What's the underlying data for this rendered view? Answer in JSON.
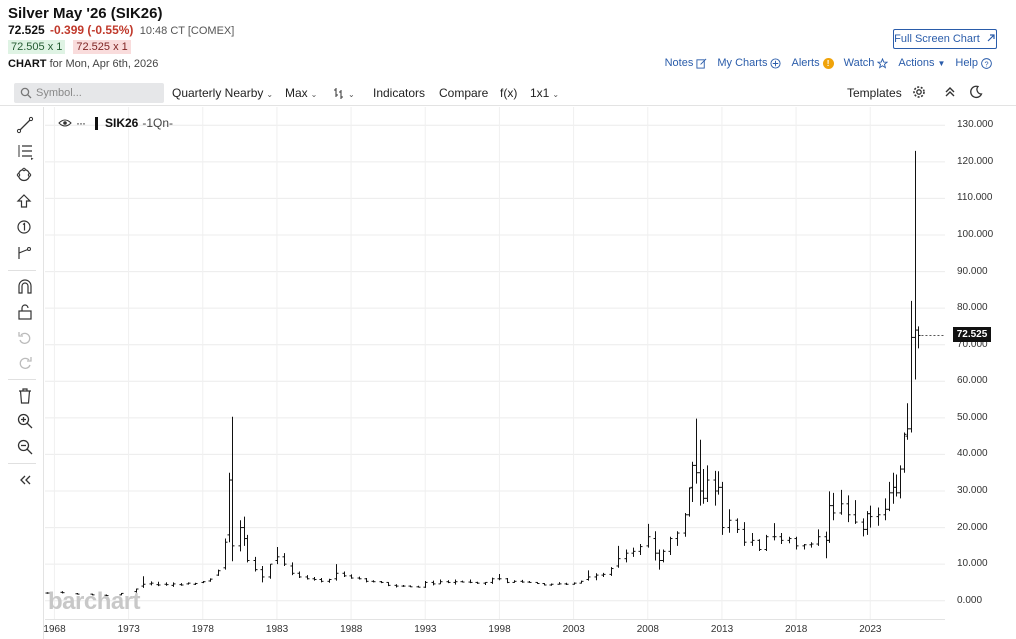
{
  "header": {
    "title": "Silver May '26 (SIK26)",
    "last": "72.525",
    "change": "-0.399 (-0.55%)",
    "time": "10:48 CT [COMEX]",
    "bid": "72.505 x 1",
    "ask": "72.525 x 1",
    "chart_label": "CHART",
    "chart_date": "for Mon, Apr 6th, 2026",
    "full_screen": "Full Screen Chart"
  },
  "links": {
    "notes": "Notes",
    "my_charts": "My Charts",
    "alerts": "Alerts",
    "watch": "Watch",
    "actions": "Actions",
    "help": "Help"
  },
  "toolbar": {
    "symbol_placeholder": "Symbol...",
    "contract": "Quarterly Nearby",
    "period": "Max",
    "indicators": "Indicators",
    "compare": "Compare",
    "fx": "f(x)",
    "layout": "1x1",
    "templates": "Templates"
  },
  "legend": {
    "symbol": "SIK26",
    "aggregation": "-1Qn-"
  },
  "last_price_label": "72.525",
  "watermark": "barchart",
  "colors": {
    "accent": "#2a5caa",
    "negative": "#c0392b",
    "bars": "#111111"
  },
  "chart_data": {
    "type": "bar",
    "style": "ohlc-quarterly",
    "ylim": [
      -5,
      135
    ],
    "yticks": [
      "0.000",
      "10.000",
      "20.000",
      "30.000",
      "40.000",
      "50.000",
      "60.000",
      "70.000",
      "80.000",
      "90.000",
      "100.000",
      "110.000",
      "120.000",
      "130.000"
    ],
    "xticks": [
      "1968",
      "1973",
      "1978",
      "1983",
      "1988",
      "1993",
      "1998",
      "2003",
      "2008",
      "2013",
      "2018",
      "2023"
    ],
    "xlim": [
      1967.5,
      2027.5
    ],
    "grid": true,
    "series": [
      {
        "values": [
          [
            1967.5,
            2.1,
            2.3,
            1.9,
            2.1
          ],
          [
            1968.5,
            2.3,
            2.6,
            2.0,
            2.2
          ],
          [
            1969.5,
            1.9,
            2.1,
            1.7,
            1.8
          ],
          [
            1970.5,
            1.8,
            1.9,
            1.5,
            1.6
          ],
          [
            1971.5,
            1.5,
            1.7,
            1.3,
            1.4
          ],
          [
            1972.5,
            1.6,
            2.1,
            1.5,
            2.0
          ],
          [
            1973.5,
            2.5,
            3.3,
            2.2,
            3.2
          ],
          [
            1974.0,
            4.0,
            6.7,
            3.5,
            4.5
          ],
          [
            1974.5,
            4.6,
            5.3,
            4.2,
            4.8
          ],
          [
            1975.0,
            4.4,
            5.2,
            4.0,
            4.3
          ],
          [
            1975.5,
            4.5,
            5.0,
            4.1,
            4.4
          ],
          [
            1976.0,
            4.2,
            5.0,
            3.8,
            4.6
          ],
          [
            1976.5,
            4.4,
            4.8,
            4.1,
            4.3
          ],
          [
            1977.0,
            4.6,
            5.0,
            4.4,
            4.8
          ],
          [
            1977.5,
            4.5,
            4.9,
            4.3,
            4.7
          ],
          [
            1978.0,
            5.0,
            5.4,
            4.8,
            5.2
          ],
          [
            1978.5,
            5.4,
            6.1,
            5.2,
            5.9
          ],
          [
            1979.0,
            7.0,
            8.5,
            6.8,
            8.2
          ],
          [
            1979.5,
            9.0,
            17.0,
            8.5,
            16.0
          ],
          [
            1979.75,
            18.0,
            35.0,
            16.0,
            33.0
          ],
          [
            1980.0,
            33.0,
            50.3,
            10.8,
            15.0
          ],
          [
            1980.5,
            15.0,
            22.0,
            13.5,
            20.0
          ],
          [
            1980.75,
            20.0,
            23.0,
            15.0,
            17.0
          ],
          [
            1981.0,
            17.0,
            18.0,
            10.5,
            11.0
          ],
          [
            1981.5,
            11.0,
            12.0,
            8.0,
            8.5
          ],
          [
            1982.0,
            8.5,
            9.5,
            5.0,
            6.5
          ],
          [
            1982.5,
            6.5,
            10.0,
            6.0,
            10.0
          ],
          [
            1983.0,
            11.0,
            14.7,
            10.0,
            12.0
          ],
          [
            1983.5,
            12.0,
            13.0,
            9.5,
            10.0
          ],
          [
            1984.0,
            9.5,
            10.5,
            7.0,
            7.5
          ],
          [
            1984.5,
            7.5,
            8.0,
            6.2,
            6.5
          ],
          [
            1985.0,
            6.5,
            7.0,
            5.8,
            6.0
          ],
          [
            1985.5,
            6.0,
            6.5,
            5.5,
            5.8
          ],
          [
            1986.0,
            5.8,
            6.2,
            5.0,
            5.3
          ],
          [
            1986.5,
            5.3,
            6.0,
            4.9,
            5.8
          ],
          [
            1987.0,
            6.0,
            10.0,
            5.5,
            7.5
          ],
          [
            1987.5,
            7.5,
            8.0,
            6.5,
            6.8
          ],
          [
            1988.0,
            6.8,
            7.2,
            6.0,
            6.2
          ],
          [
            1988.5,
            6.2,
            6.6,
            5.8,
            6.0
          ],
          [
            1989.0,
            6.0,
            6.2,
            5.0,
            5.3
          ],
          [
            1989.5,
            5.3,
            5.6,
            5.0,
            5.2
          ],
          [
            1990.0,
            5.2,
            5.4,
            4.8,
            5.0
          ],
          [
            1990.5,
            5.0,
            5.1,
            4.0,
            4.2
          ],
          [
            1991.0,
            4.2,
            4.5,
            3.6,
            4.0
          ],
          [
            1991.5,
            4.0,
            4.3,
            3.8,
            4.0
          ],
          [
            1992.0,
            4.0,
            4.2,
            3.7,
            3.8
          ],
          [
            1992.5,
            3.8,
            4.1,
            3.6,
            3.7
          ],
          [
            1993.0,
            3.7,
            5.4,
            3.5,
            5.0
          ],
          [
            1993.5,
            5.0,
            5.5,
            4.2,
            4.6
          ],
          [
            1994.0,
            4.6,
            5.8,
            4.6,
            5.2
          ],
          [
            1994.5,
            5.2,
            5.6,
            4.8,
            5.0
          ],
          [
            1995.0,
            5.0,
            5.8,
            4.4,
            5.2
          ],
          [
            1995.5,
            5.2,
            5.5,
            5.0,
            5.1
          ],
          [
            1996.0,
            5.1,
            5.8,
            4.8,
            5.0
          ],
          [
            1996.5,
            5.0,
            5.2,
            4.6,
            4.8
          ],
          [
            1997.0,
            4.8,
            5.1,
            4.3,
            5.0
          ],
          [
            1997.5,
            5.0,
            6.3,
            4.6,
            6.0
          ],
          [
            1998.0,
            6.0,
            7.3,
            5.6,
            6.0
          ],
          [
            1998.5,
            6.0,
            6.2,
            4.8,
            5.0
          ],
          [
            1999.0,
            5.0,
            5.6,
            4.9,
            5.3
          ],
          [
            1999.5,
            5.3,
            5.7,
            4.9,
            5.1
          ],
          [
            2000.0,
            5.1,
            5.4,
            4.9,
            5.0
          ],
          [
            2000.5,
            5.0,
            5.1,
            4.6,
            4.7
          ],
          [
            2001.0,
            4.7,
            4.8,
            4.2,
            4.3
          ],
          [
            2001.5,
            4.3,
            4.7,
            4.1,
            4.5
          ],
          [
            2002.0,
            4.5,
            5.1,
            4.4,
            4.6
          ],
          [
            2002.5,
            4.6,
            4.9,
            4.3,
            4.5
          ],
          [
            2003.0,
            4.5,
            5.0,
            4.4,
            4.8
          ],
          [
            2003.5,
            4.8,
            5.5,
            4.7,
            5.3
          ],
          [
            2004.0,
            5.8,
            8.3,
            5.5,
            6.5
          ],
          [
            2004.5,
            6.5,
            7.5,
            5.6,
            7.0
          ],
          [
            2005.0,
            7.0,
            7.6,
            6.5,
            7.2
          ],
          [
            2005.5,
            7.2,
            9.2,
            6.8,
            8.8
          ],
          [
            2006.0,
            9.5,
            15.0,
            9.0,
            11.5
          ],
          [
            2006.5,
            11.5,
            14.0,
            10.5,
            13.0
          ],
          [
            2007.0,
            13.0,
            14.5,
            12.0,
            13.5
          ],
          [
            2007.5,
            13.5,
            15.5,
            12.5,
            14.8
          ],
          [
            2008.0,
            15.0,
            21.0,
            14.5,
            17.5
          ],
          [
            2008.5,
            17.0,
            19.0,
            11.0,
            13.0
          ],
          [
            2008.75,
            13.0,
            14.0,
            8.5,
            11.0
          ],
          [
            2009.0,
            11.0,
            14.0,
            10.5,
            13.5
          ],
          [
            2009.5,
            13.5,
            17.5,
            12.5,
            17.0
          ],
          [
            2010.0,
            17.0,
            19.0,
            15.0,
            18.5
          ],
          [
            2010.5,
            18.5,
            24.0,
            17.5,
            23.5
          ],
          [
            2010.75,
            23.5,
            31.0,
            23.0,
            30.8
          ],
          [
            2011.0,
            31.0,
            38.0,
            27.0,
            37.0
          ],
          [
            2011.25,
            37.0,
            49.8,
            32.0,
            35.0
          ],
          [
            2011.5,
            35.0,
            44.0,
            26.0,
            30.0
          ],
          [
            2011.75,
            30.0,
            36.0,
            26.5,
            28.0
          ],
          [
            2012.0,
            28.0,
            37.0,
            27.0,
            33.0
          ],
          [
            2012.5,
            33.0,
            35.5,
            26.0,
            30.0
          ],
          [
            2012.75,
            30.0,
            35.4,
            29.0,
            31.0
          ],
          [
            2013.0,
            31.0,
            32.5,
            18.0,
            20.0
          ],
          [
            2013.5,
            20.0,
            25.0,
            18.6,
            22.0
          ],
          [
            2014.0,
            22.0,
            22.5,
            18.5,
            19.5
          ],
          [
            2014.5,
            19.5,
            21.5,
            15.0,
            16.0
          ],
          [
            2015.0,
            16.0,
            18.5,
            15.0,
            16.5
          ],
          [
            2015.5,
            16.5,
            16.8,
            13.6,
            14.0
          ],
          [
            2016.0,
            14.0,
            18.0,
            13.6,
            17.5
          ],
          [
            2016.5,
            17.5,
            21.2,
            16.5,
            17.5
          ],
          [
            2017.0,
            17.5,
            18.5,
            15.5,
            16.5
          ],
          [
            2017.5,
            16.5,
            17.5,
            15.7,
            17.0
          ],
          [
            2018.0,
            17.0,
            17.5,
            14.0,
            15.0
          ],
          [
            2018.5,
            15.0,
            15.5,
            14.0,
            15.3
          ],
          [
            2019.0,
            15.3,
            16.0,
            14.5,
            15.5
          ],
          [
            2019.5,
            15.5,
            19.5,
            15.0,
            17.5
          ],
          [
            2020.0,
            17.5,
            18.9,
            11.6,
            16.5
          ],
          [
            2020.25,
            16.5,
            29.9,
            15.8,
            26.0
          ],
          [
            2020.5,
            26.0,
            29.5,
            22.0,
            24.0
          ],
          [
            2021.0,
            24.0,
            30.3,
            23.5,
            26.5
          ],
          [
            2021.5,
            26.5,
            28.8,
            21.5,
            23.5
          ],
          [
            2022.0,
            23.5,
            27.5,
            21.0,
            21.5
          ],
          [
            2022.5,
            21.5,
            22.5,
            17.6,
            19.5
          ],
          [
            2022.75,
            19.5,
            24.5,
            18.0,
            23.8
          ],
          [
            2023.0,
            23.8,
            26.0,
            20.0,
            23.0
          ],
          [
            2023.5,
            23.0,
            25.5,
            20.5,
            23.5
          ],
          [
            2024.0,
            23.5,
            28.0,
            22.0,
            25.0
          ],
          [
            2024.25,
            25.0,
            32.5,
            24.5,
            29.5
          ],
          [
            2024.5,
            29.5,
            35.0,
            26.5,
            31.0
          ],
          [
            2024.75,
            31.0,
            34.5,
            28.5,
            29.5
          ],
          [
            2025.0,
            29.5,
            37.0,
            28.0,
            36.0
          ],
          [
            2025.25,
            36.0,
            46.0,
            35.0,
            45.5
          ],
          [
            2025.5,
            45.0,
            54.0,
            44.0,
            47.0
          ],
          [
            2025.75,
            47.0,
            82.0,
            46.0,
            72.0
          ],
          [
            2026.0,
            72.0,
            123.0,
            60.5,
            74.0
          ],
          [
            2026.25,
            74.0,
            75.0,
            69.0,
            72.525
          ]
        ]
      }
    ]
  }
}
